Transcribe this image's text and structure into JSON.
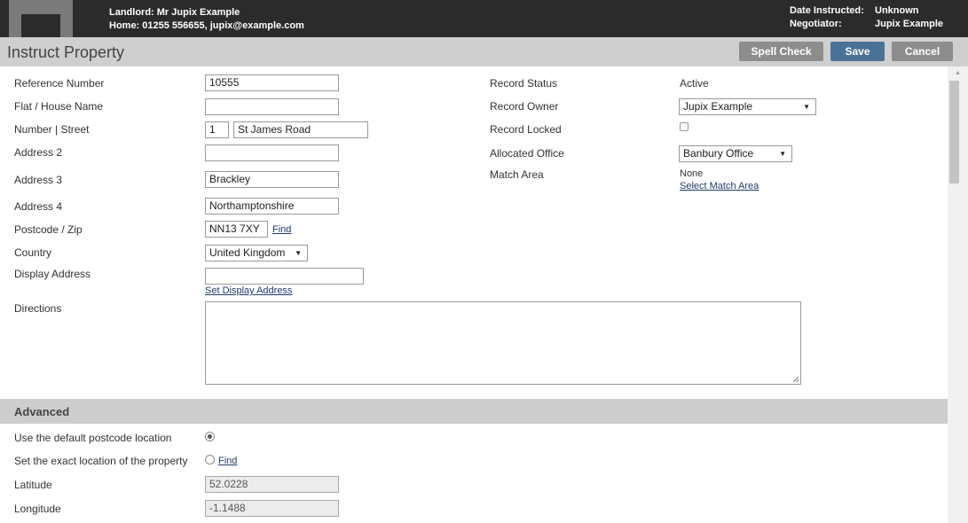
{
  "header": {
    "landlord": "Landlord: Mr Jupix Example",
    "contact": "Home: 01255 556655, jupix@example.com",
    "date_instructed_label": "Date Instructed:",
    "date_instructed_value": "Unknown",
    "negotiator_label": "Negotiator:",
    "negotiator_value": "Jupix Example"
  },
  "toolbar": {
    "title": "Instruct Property",
    "spell_check": "Spell Check",
    "save": "Save",
    "cancel": "Cancel"
  },
  "form": {
    "reference_label": "Reference Number",
    "reference_value": "10555",
    "flat_label": "Flat / House Name",
    "flat_value": "",
    "number_street_label": "Number | Street",
    "number_value": "1",
    "street_value": "St James Road",
    "address2_label": "Address 2",
    "address2_value": "",
    "address3_label": "Address 3",
    "address3_value": "Brackley",
    "address4_label": "Address 4",
    "address4_value": "Northamptonshire",
    "postcode_label": "Postcode / Zip",
    "postcode_value": "NN13 7XY",
    "find_label": "Find",
    "country_label": "Country",
    "country_value": "United Kingdom",
    "display_address_label": "Display Address",
    "display_address_value": "",
    "set_display_address": "Set Display Address",
    "directions_label": "Directions",
    "directions_value": ""
  },
  "record": {
    "status_label": "Record Status",
    "status_value": "Active",
    "owner_label": "Record Owner",
    "owner_value": "Jupix Example",
    "locked_label": "Record Locked",
    "locked": false,
    "office_label": "Allocated Office",
    "office_value": "Banbury Office",
    "match_area_label": "Match Area",
    "match_area_value": "None",
    "select_match_area": "Select Match Area"
  },
  "advanced": {
    "title": "Advanced",
    "default_postcode_label": "Use the default postcode location",
    "default_postcode_selected": true,
    "exact_location_label": "Set the exact location of the property",
    "exact_location_selected": false,
    "find_label": "Find",
    "latitude_label": "Latitude",
    "latitude_value": "52.0228",
    "longitude_label": "Longitude",
    "longitude_value": "-1.1488"
  },
  "icons": {
    "dropdown": "chevron-down-icon",
    "resize": "resize-grip-icon",
    "logo": "jupix-logo"
  }
}
